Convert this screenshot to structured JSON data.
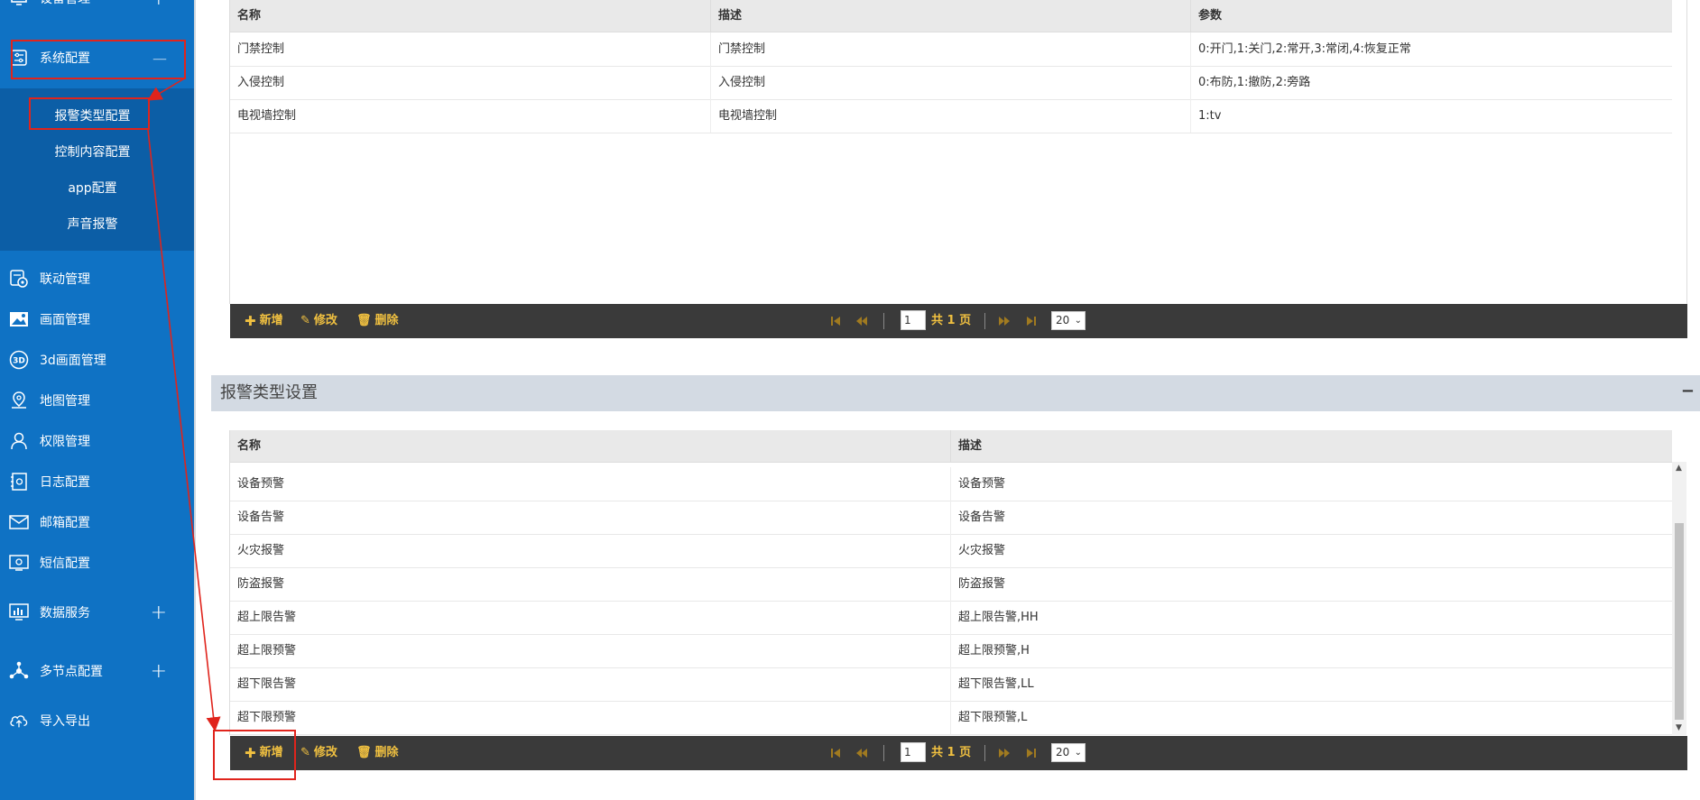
{
  "sidebar": {
    "top_item": {
      "label": "设备管理",
      "expander": "+"
    },
    "system_config": {
      "label": "系统配置",
      "expander": "—"
    },
    "sub_items": [
      {
        "label": "报警类型配置"
      },
      {
        "label": "控制内容配置"
      },
      {
        "label": "app配置"
      },
      {
        "label": "声音报警"
      }
    ],
    "items": [
      {
        "label": "联动管理",
        "icon": "linkage-icon"
      },
      {
        "label": "画面管理",
        "icon": "picture-icon"
      },
      {
        "label": "3d画面管理",
        "icon": "3d-icon",
        "icon_text": "3D"
      },
      {
        "label": "地图管理",
        "icon": "map-pin-icon"
      },
      {
        "label": "权限管理",
        "icon": "user-icon"
      },
      {
        "label": "日志配置",
        "icon": "log-icon"
      },
      {
        "label": "邮箱配置",
        "icon": "mail-icon"
      },
      {
        "label": "短信配置",
        "icon": "sms-icon"
      },
      {
        "label": "数据服务",
        "icon": "monitor-icon",
        "expander": "+"
      },
      {
        "label": "多节点配置",
        "icon": "nodes-icon",
        "expander": "+"
      },
      {
        "label": "导入导出",
        "icon": "cloud-icon"
      }
    ]
  },
  "control_table": {
    "columns": [
      "名称",
      "描述",
      "参数"
    ],
    "rows": [
      [
        "门禁控制",
        "门禁控制",
        "0:开门,1:关门,2:常开,3:常闭,4:恢复正常"
      ],
      [
        "入侵控制",
        "入侵控制",
        "0:布防,1:撤防,2:旁路"
      ],
      [
        "电视墙控制",
        "电视墙控制",
        "1:tv"
      ]
    ]
  },
  "pager_common": {
    "add": "新增",
    "edit": "修改",
    "delete": "删除",
    "page": "1",
    "total": "共 1 页",
    "page_size": "20"
  },
  "alarm_section": {
    "title": "报警类型设置",
    "toggle": "−",
    "columns": [
      "名称",
      "描述"
    ],
    "rows": [
      [
        "设备预警",
        "设备预警"
      ],
      [
        "设备告警",
        "设备告警"
      ],
      [
        "火灾报警",
        "火灾报警"
      ],
      [
        "防盗报警",
        "防盗报警"
      ],
      [
        "超上限告警",
        "超上限告警,HH"
      ],
      [
        "超上限预警",
        "超上限预警,H"
      ],
      [
        "超下限告警",
        "超下限告警,LL"
      ],
      [
        "超下限预警",
        "超下限预警,L"
      ]
    ]
  },
  "colors": {
    "sidebar": "#0f72c4",
    "sidebar_sub": "#0c5ea6",
    "pager": "#3a3a3a",
    "pager_text": "#f0c040",
    "annotation": "#e0241c"
  }
}
